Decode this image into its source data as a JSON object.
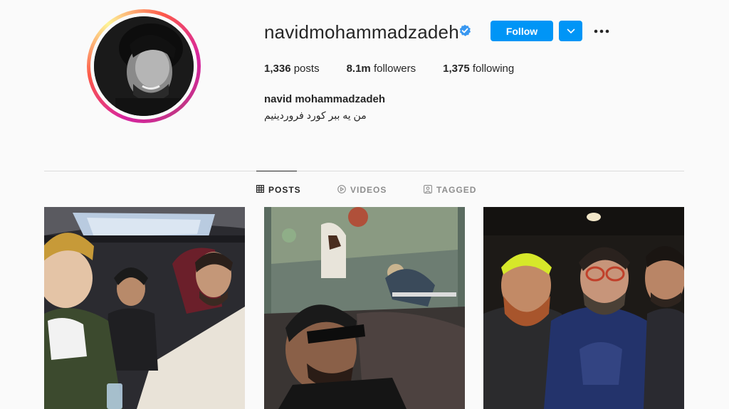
{
  "profile": {
    "username": "navidmohammadzadeh",
    "full_name": "navid mohammadzadeh",
    "bio": "من یه ببر کورد فروردینیم",
    "verified": true
  },
  "actions": {
    "follow_label": "Follow"
  },
  "stats": {
    "posts_count": "1,336",
    "posts_label": "posts",
    "followers_count": "8.1m",
    "followers_label": "followers",
    "following_count": "1,375",
    "following_label": "following"
  },
  "tabs": [
    {
      "label": "POSTS",
      "icon": "grid-icon",
      "active": true
    },
    {
      "label": "VIDEOS",
      "icon": "play-icon",
      "active": false
    },
    {
      "label": "TAGGED",
      "icon": "tag-icon",
      "active": false
    }
  ],
  "colors": {
    "accent": "#0095f6",
    "verified": "#3897f0",
    "text": "#262626",
    "muted": "#8e8e8e",
    "background": "#fafafa"
  }
}
